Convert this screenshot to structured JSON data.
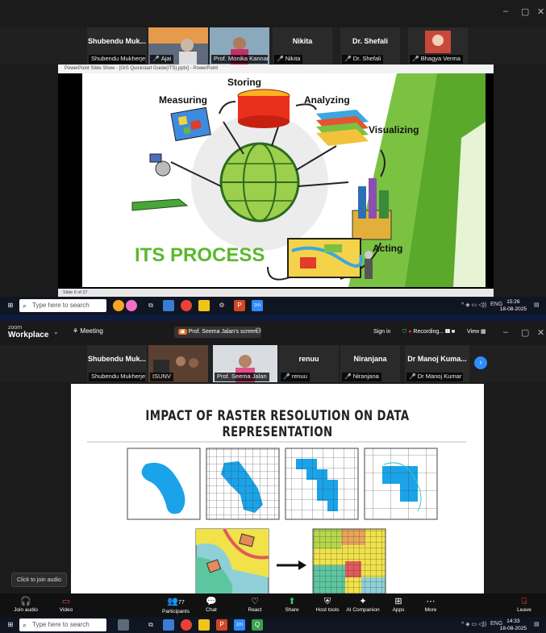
{
  "top": {
    "window_controls": [
      "–",
      "▢",
      "✕"
    ],
    "gallery": [
      {
        "name": "Shubendu Muk...",
        "caption": "Shubendu Mukherjee",
        "muted": false
      },
      {
        "name": "",
        "caption": "Ajai",
        "muted": true
      },
      {
        "name": "",
        "caption": "Prof. Monika Kannan",
        "muted": false
      },
      {
        "name": "Nikita",
        "caption": "Nikita",
        "muted": true
      },
      {
        "name": "Dr. Shefali",
        "caption": "Dr. Shefali",
        "muted": true
      },
      {
        "name": "",
        "caption": "Bhagya Verma",
        "muted": true
      }
    ],
    "ppt_window_title": "PowerPoint Slide Show - [GIS Quickstart Guide(ITS).pptx] - PowerPoint",
    "ppt_status": "Slide 6 of 27",
    "slide": {
      "labels": {
        "storing": "Storing",
        "measuring": "Measuring",
        "analyzing": "Analyzing",
        "visualizing": "Visualizing",
        "acting": "Acting"
      },
      "title": "ITS PROCESS"
    },
    "taskbar": {
      "search_placeholder": "Type here to search",
      "tray_lang": "ENG",
      "time": "15:26",
      "date": "18-08-2025"
    }
  },
  "bottom": {
    "zoom_small": "zoom",
    "zoom_big": "Workplace",
    "meeting_label": "Meeting",
    "screen_share_label": "Prof. Seema Jalan's screen",
    "sign_in": "Sign in",
    "recording": "Recording...",
    "view": "View",
    "gallery": [
      {
        "name": "Shubendu Muk...",
        "caption": "Shubendu Mukherjee",
        "muted": false
      },
      {
        "name": "",
        "caption": "ISUNV",
        "muted": false
      },
      {
        "name": "",
        "caption": "Prof. Seema Jalan",
        "muted": false
      },
      {
        "name": "renuu",
        "caption": "renuu",
        "muted": true
      },
      {
        "name": "Niranjana",
        "caption": "Niranjana",
        "muted": true
      },
      {
        "name": "Dr Manoj Kuma...",
        "caption": "Dr Manoj Kumar Saini",
        "muted": true
      }
    ],
    "slide_title": "IMPACT OF RASTER RESOLUTION ON DATA REPRESENTATION",
    "tooltip": "Click to join audio",
    "controls": [
      {
        "icon": "headphones-icon",
        "glyph": "🎧",
        "label": "Join audio"
      },
      {
        "icon": "video-icon",
        "glyph": "▭",
        "label": "Video"
      },
      {
        "icon": "participants-icon",
        "glyph": "👥",
        "label": "Participants"
      },
      {
        "icon": "chat-icon",
        "glyph": "💬",
        "label": "Chat"
      },
      {
        "icon": "react-icon",
        "glyph": "♡",
        "label": "React"
      },
      {
        "icon": "share-icon",
        "glyph": "⬆",
        "label": "Share"
      },
      {
        "icon": "host-tools-icon",
        "glyph": "⛨",
        "label": "Host tools"
      },
      {
        "icon": "ai-companion-icon",
        "glyph": "✦",
        "label": "AI Companion"
      },
      {
        "icon": "apps-icon",
        "glyph": "⊞",
        "label": "Apps"
      },
      {
        "icon": "more-icon",
        "glyph": "⋯",
        "label": "More"
      },
      {
        "icon": "leave-icon",
        "glyph": "⍈",
        "label": "Leave"
      }
    ],
    "participants_count": "77",
    "taskbar": {
      "search_placeholder": "Type here to search",
      "tray_lang": "ENG",
      "time": "14:33",
      "date": "18-08-2025"
    }
  },
  "colors": {
    "zoom_green": "#38d86a",
    "slide_green": "#5cb82e",
    "raster_blue": "#1aa3e8"
  }
}
